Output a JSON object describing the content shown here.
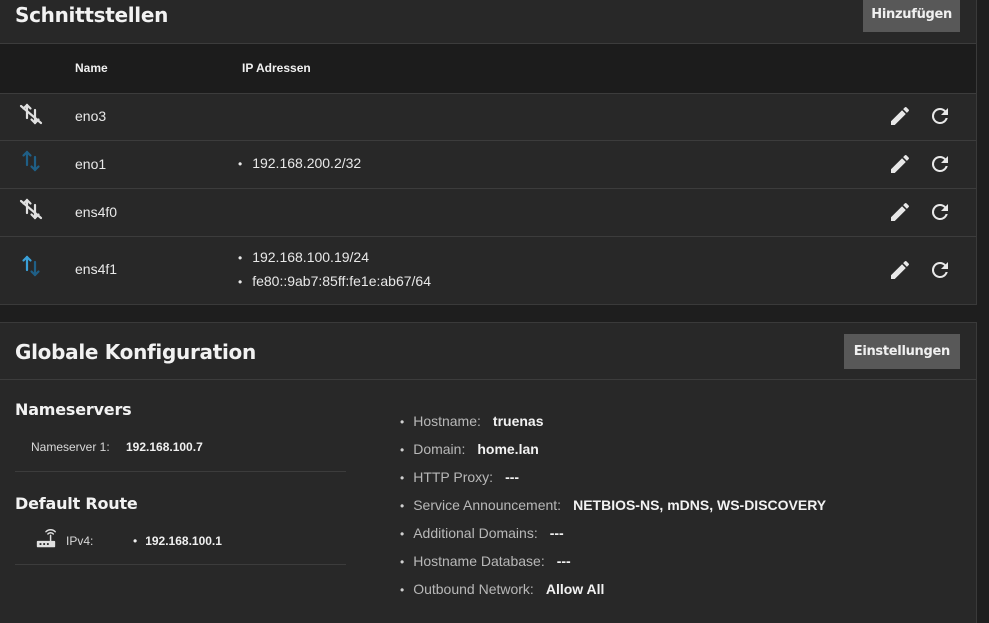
{
  "interfaces": {
    "title": "Schnittstellen",
    "add_button": "Hinzufügen",
    "columns": {
      "name": "Name",
      "ip": "IP Adressen"
    },
    "rows": [
      {
        "status": "link-down-icon",
        "name": "eno3",
        "ips": []
      },
      {
        "status": "link-up-icon",
        "name": "eno1",
        "ips": [
          "192.168.200.2/32"
        ]
      },
      {
        "status": "link-down-icon",
        "name": "ens4f0",
        "ips": []
      },
      {
        "status": "link-up-icon",
        "name": "ens4f1",
        "ips": [
          "192.168.100.19/24",
          "fe80::9ab7:85ff:fe1e:ab67/64"
        ]
      }
    ]
  },
  "global": {
    "title": "Globale Konfiguration",
    "settings_button": "Einstellungen",
    "nameservers": {
      "title": "Nameservers",
      "label": "Nameserver 1:",
      "value": "192.168.100.7"
    },
    "default_route": {
      "title": "Default Route",
      "label": "IPv4:",
      "value": "192.168.100.1"
    },
    "info": [
      {
        "label": "Hostname:",
        "value": "truenas"
      },
      {
        "label": "Domain:",
        "value": "home.lan"
      },
      {
        "label": "HTTP Proxy:",
        "value": "---"
      },
      {
        "label": "Service Announcement:",
        "value": "NETBIOS-NS, mDNS, WS-DISCOVERY"
      },
      {
        "label": "Additional Domains:",
        "value": "---"
      },
      {
        "label": "Hostname Database:",
        "value": "---"
      },
      {
        "label": "Outbound Network:",
        "value": "Allow All"
      }
    ]
  },
  "colors": {
    "background": "#1e1e1e",
    "card": "#282828",
    "button": "#585858",
    "link_up_active": "#3aa0d8",
    "link_up_idle": "#1f5f86"
  }
}
